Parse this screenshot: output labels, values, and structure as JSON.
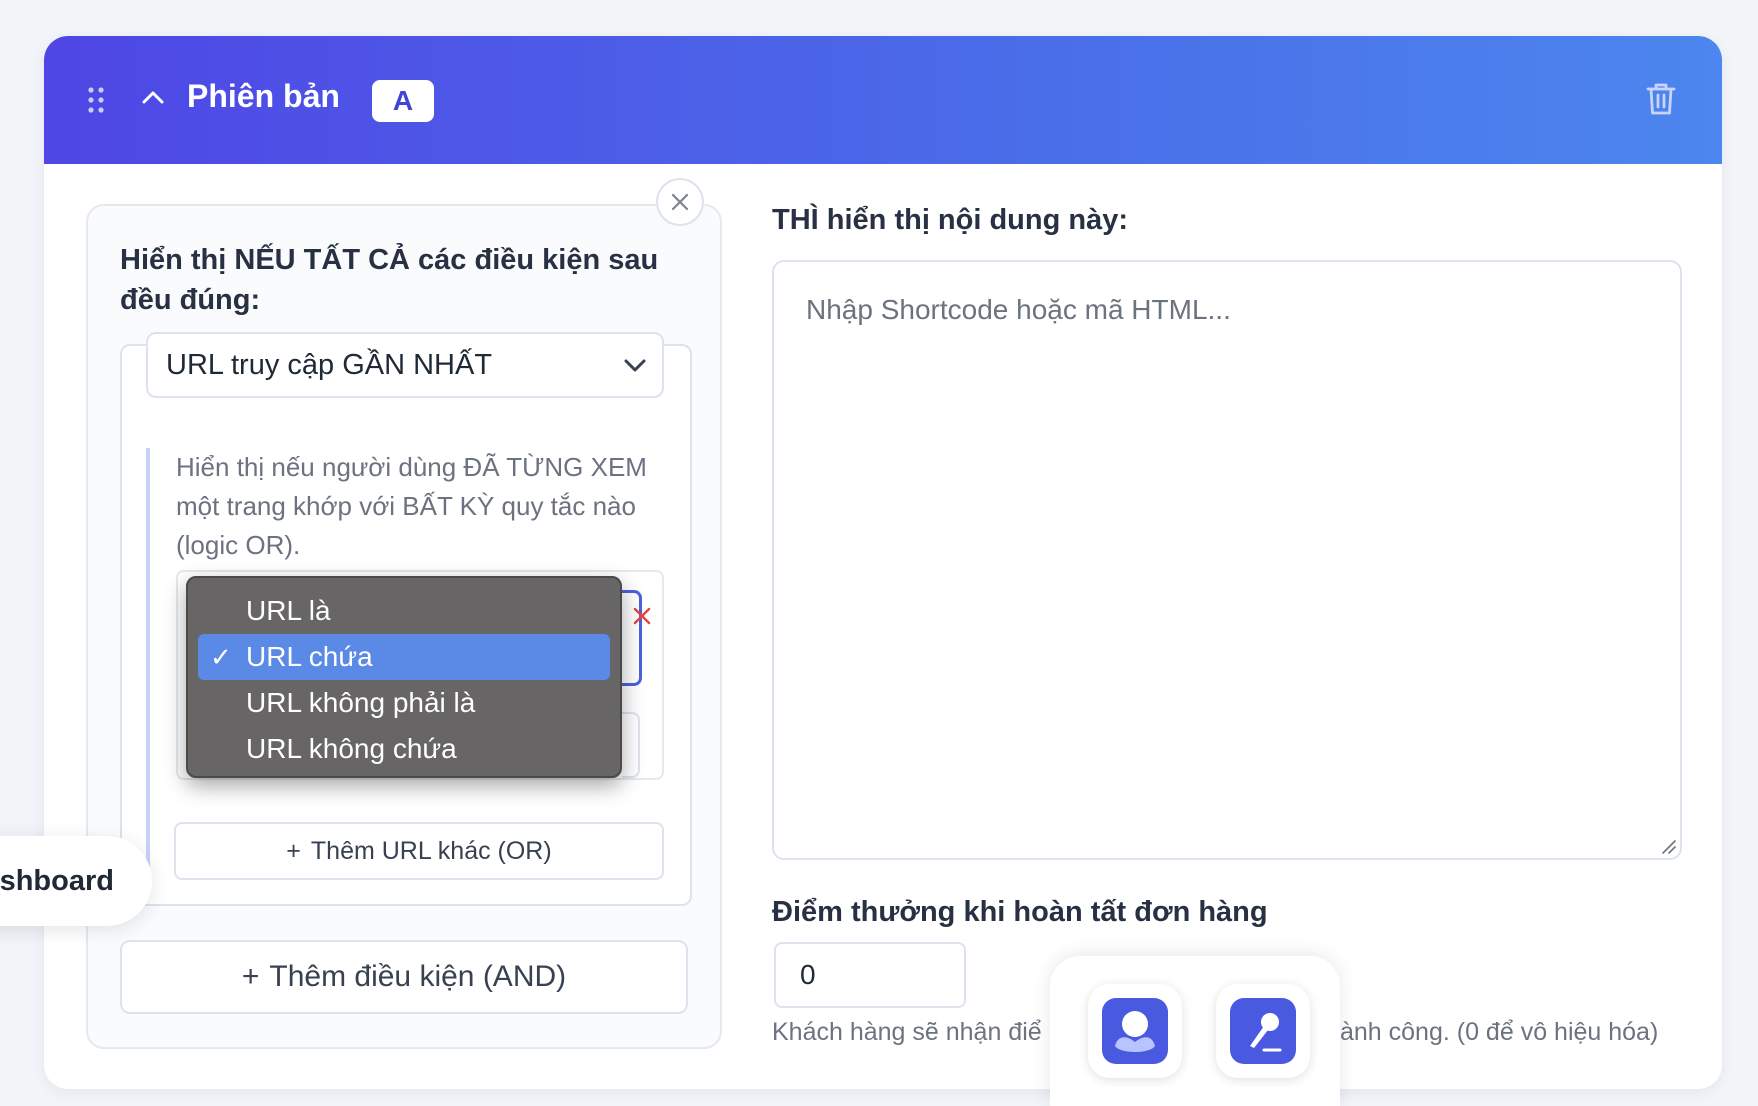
{
  "colors": {
    "header_gradient_start": "#4f46e5",
    "header_gradient_end": "#4c86ee",
    "accent": "#4a5ae0",
    "dropdown_bg": "#676565",
    "dropdown_selected": "#5b8ae6"
  },
  "header": {
    "title": "Phiên bản",
    "badge": "A",
    "icons": [
      "drag-handle-icon",
      "chevron-up-icon",
      "trash-icon"
    ]
  },
  "conditions": {
    "heading": "Hiển thị NẾU TẤT CẢ các điều kiện sau đều đúng:",
    "condition_type": "URL truy cập GẦN NHẤT",
    "rule_description": "Hiển thị nếu người dùng ĐÃ TỪNG XEM một trang khớp với BẤT KỲ quy tắc nào (logic OR).",
    "add_url_label": "Thêm URL khác (OR)",
    "add_condition_label": "Thêm điều kiện (AND)"
  },
  "dropdown": {
    "options": [
      "URL là",
      "URL chứa",
      "URL không phải là",
      "URL không chứa"
    ],
    "selected": "URL chứa",
    "check_mark": "✓"
  },
  "content": {
    "label": "THÌ hiển thị nội dung này:",
    "placeholder": "Nhập Shortcode hoặc mã HTML...",
    "value": ""
  },
  "points": {
    "label": "Điểm thưởng khi hoàn tất đơn hàng",
    "value": "0",
    "help_left": "Khách hàng sẽ nhận điể",
    "help_right": "ành công. (0 để vô hiệu hóa)"
  },
  "floating": {
    "dashboard_label": "shboard",
    "dock_apps": [
      "avatar-app-icon",
      "pen-app-icon"
    ]
  }
}
